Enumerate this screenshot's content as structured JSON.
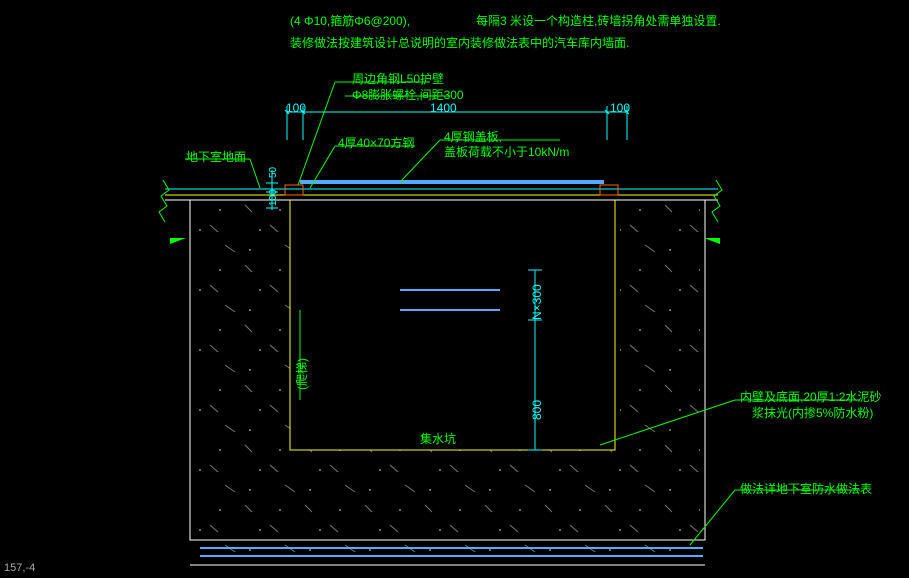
{
  "notes": {
    "line1a": "(4 Φ10,箍筋Φ6@200),",
    "line1b": "每隔3 米设一个构造柱,砖墙拐角处需单独设置.",
    "line2": "装修做法按建筑设计总说明的室内装修做法表中的汽车库内墙面."
  },
  "labels": {
    "angle_steel": "周边角钢L50护壁",
    "bolt": "Φ8膨胀螺栓,间距300",
    "square_tube": "4厚40×70方钢",
    "cover_plate": "4厚钢盖板,",
    "cover_load": "盖板荷载不小于10kN/m",
    "basement_floor": "地下室地面",
    "ladder": "(爬梯)",
    "pit_name": "集水坑",
    "inner_wall_1": "内壁及底面,20厚1:2水泥砂",
    "inner_wall_2": "浆抹光(内掺5%防水粉)",
    "waterproof_ref": "做法详地下室防水做法表"
  },
  "dims": {
    "d_left": "100",
    "d_mid": "1400",
    "d_right": "100",
    "v_top": "50",
    "v_100": "100",
    "n300": "N×300",
    "d800": "800"
  },
  "coord": "157,-4"
}
